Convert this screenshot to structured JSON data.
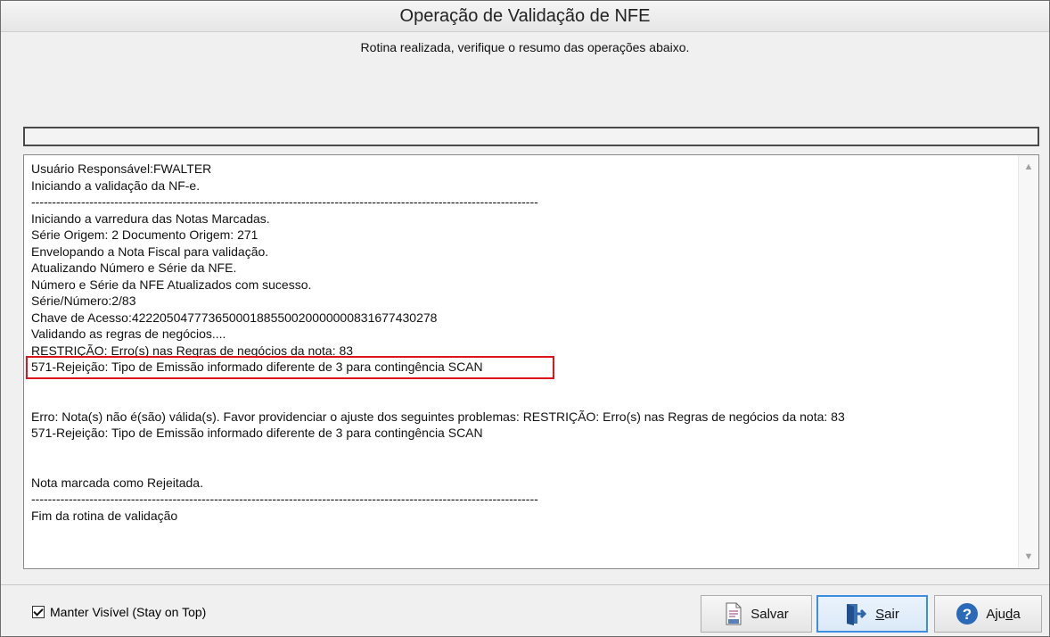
{
  "window": {
    "title": "Operação de Validação de NFE"
  },
  "header": {
    "message": "Rotina realizada, verifique o resumo das operações abaixo."
  },
  "progress": {
    "value_percent": 0
  },
  "log": {
    "lines": [
      "Usuário Responsável:FWALTER",
      "Iniciando a validação da NF-e.",
      "--------------------------------------------------------------------------------------------------------------------------",
      "Iniciando a varredura das Notas Marcadas.",
      "Série Origem: 2 Documento Origem: 271",
      "Envelopando a Nota Fiscal para validação.",
      "Atualizando Número e Série da NFE.",
      "Número e Série da NFE Atualizados com sucesso.",
      "Série/Número:2/83",
      "Chave de Acesso:42220504777365000188550020000000831677430278",
      "Validando as regras de negócios....",
      "RESTRIÇÃO: Erro(s) nas Regras de negócios da nota: 83",
      "571-Rejeição: Tipo de Emissão informado diferente de 3 para contingência SCAN",
      "",
      "",
      "Erro: Nota(s) não é(são) válida(s). Favor providenciar o ajuste dos seguintes problemas: RESTRIÇÃO: Erro(s) nas Regras de negócios da nota: 83",
      "571-Rejeição: Tipo de Emissão informado diferente de 3 para contingência SCAN",
      "",
      "",
      "Nota marcada como Rejeitada.",
      "--------------------------------------------------------------------------------------------------------------------------",
      "Fim da rotina de validação"
    ],
    "highlight_color": "#e0141c"
  },
  "footer": {
    "stay_on_top_label": "Manter Visível (Stay on Top)",
    "stay_on_top_checked": true,
    "save_label": "Salvar",
    "exit_label_underlined": "S",
    "exit_label_rest": "air",
    "help_label_prefix": "Aju",
    "help_label_underlined": "d",
    "help_label_suffix": "a"
  },
  "icons": {
    "save": "log-file-icon",
    "exit": "exit-door-icon",
    "help": "question-circle-icon",
    "scroll_up": "chevron-up-icon",
    "scroll_down": "chevron-down-icon"
  }
}
